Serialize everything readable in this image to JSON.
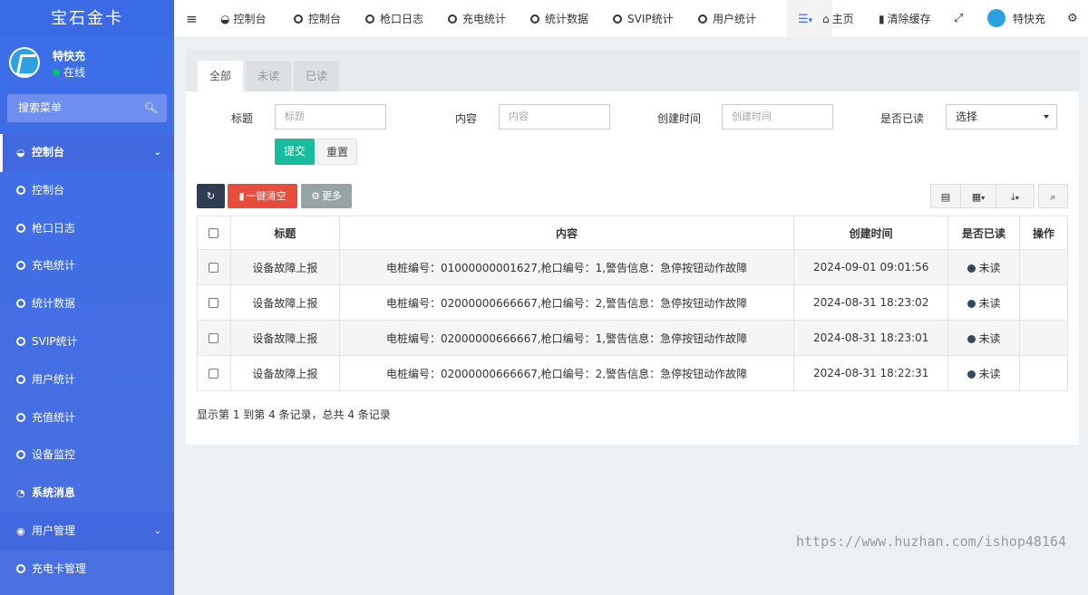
{
  "sidebar": {
    "brand": "宝石金卡",
    "user": {
      "name": "特快充",
      "status": "在线"
    },
    "search_placeholder": "搜索菜单",
    "items": [
      {
        "label": "控制台",
        "type": "header"
      },
      {
        "label": "控制台"
      },
      {
        "label": "枪口日志"
      },
      {
        "label": "充电统计"
      },
      {
        "label": "统计数据"
      },
      {
        "label": "SVIP统计"
      },
      {
        "label": "用户统计"
      },
      {
        "label": "充值统计"
      },
      {
        "label": "设备监控"
      },
      {
        "label": "系统消息"
      },
      {
        "label": "用户管理",
        "type": "header"
      },
      {
        "label": "充电卡管理"
      }
    ]
  },
  "topbar": {
    "tabs": [
      "控制台",
      "控制台",
      "枪口日志",
      "充电统计",
      "统计数据",
      "SVIP统计",
      "用户统计"
    ],
    "home": "主页",
    "clear_cache": "清除缓存",
    "user": "特快充"
  },
  "panel": {
    "tabs": [
      "全部",
      "未读",
      "已读"
    ],
    "form": {
      "title_label": "标题",
      "title_placeholder": "标题",
      "content_label": "内容",
      "content_placeholder": "内容",
      "created_label": "创建时间",
      "created_placeholder": "创建时间",
      "read_label": "是否已读",
      "read_value": "选择",
      "submit": "提交",
      "reset": "重置"
    },
    "toolbar": {
      "clear": "一键清空",
      "more": "更多"
    },
    "table": {
      "columns": [
        "标题",
        "内容",
        "创建时间",
        "是否已读",
        "操作"
      ],
      "rows": [
        {
          "title": "设备故障上报",
          "content": "电桩编号：01000000001627,枪口编号：1,警告信息：急停按钮动作故障",
          "time": "2024-09-01 09:01:56",
          "read": "未读"
        },
        {
          "title": "设备故障上报",
          "content": "电桩编号：02000000666667,枪口编号：2,警告信息：急停按钮动作故障",
          "time": "2024-08-31 18:23:02",
          "read": "未读"
        },
        {
          "title": "设备故障上报",
          "content": "电桩编号：02000000666667,枪口编号：1,警告信息：急停按钮动作故障",
          "time": "2024-08-31 18:23:01",
          "read": "未读"
        },
        {
          "title": "设备故障上报",
          "content": "电桩编号：02000000666667,枪口编号：2,警告信息：急停按钮动作故障",
          "time": "2024-08-31 18:22:31",
          "read": "未读"
        }
      ]
    },
    "summary": "显示第 1 到第 4 条记录，总共 4 条记录"
  },
  "watermark": "https://www.huzhan.com/ishop48164",
  "colors": {
    "sidebar": "#4a6fe0",
    "submit": "#18bc9c",
    "clear": "#e74c3c",
    "refresh": "#2c3e50"
  }
}
